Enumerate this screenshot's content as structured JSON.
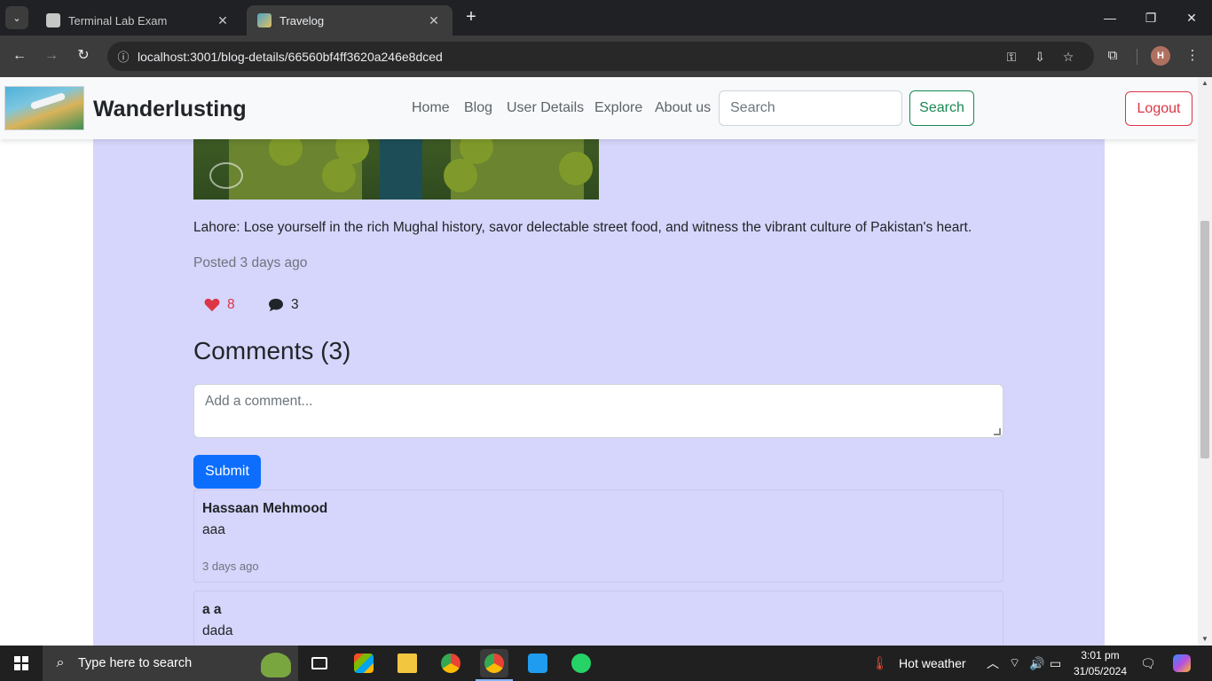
{
  "browser": {
    "tabs": [
      {
        "title": "Terminal Lab Exam",
        "active": false
      },
      {
        "title": "Travelog",
        "active": true
      }
    ],
    "url": "localhost:3001/blog-details/66560bf4ff3620a246e8dced"
  },
  "navbar": {
    "brand": "Wanderlusting",
    "links": [
      "Home",
      "Blog",
      "User Details",
      "Explore",
      "About us"
    ],
    "search_placeholder": "Search",
    "search_button": "Search",
    "logout_button": "Logout"
  },
  "post": {
    "text": "Lahore: Lose yourself in the rich Mughal history, savor delectable street food, and witness the vibrant culture of Pakistan's heart.",
    "posted": "Posted 3 days ago",
    "likes": "8",
    "comment_count": "3"
  },
  "comments_section": {
    "title": "Comments (3)",
    "input_placeholder": "Add a comment...",
    "submit_label": "Submit",
    "items": [
      {
        "author": "Hassaan Mehmood",
        "body": "aaa",
        "time": "3 days ago"
      },
      {
        "author": "a a",
        "body": "dada",
        "time": ""
      }
    ]
  },
  "taskbar": {
    "search_text": "Type here to search",
    "weather": "Hot weather",
    "time": "3:01 pm",
    "date": "31/05/2024"
  },
  "colors": {
    "page_background": "#d6d5fb",
    "like_red": "#dc3545",
    "search_green": "#198754",
    "submit_blue": "#0d6efd"
  }
}
